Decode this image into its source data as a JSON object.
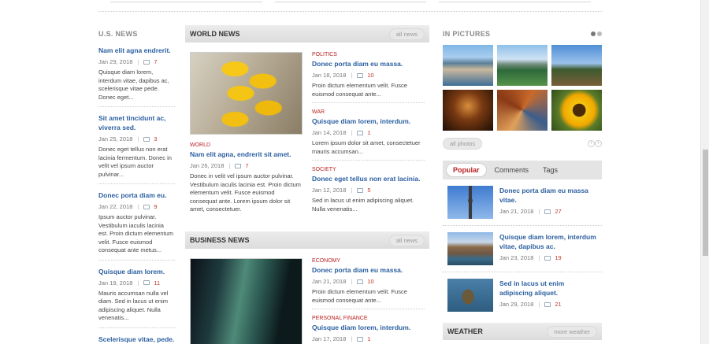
{
  "us_news": {
    "title": "U.S. NEWS",
    "items": [
      {
        "title": "Nam elit agna endrerit.",
        "date": "Jan 29, 2018",
        "comments": "7",
        "text": "Quisque diam lorem, interdum vitae, dapibus ac, scelerisque vitae pede. Donec eget..."
      },
      {
        "title": "Sit amet tincidunt ac, viverra sed.",
        "date": "Jan 25, 2018",
        "comments": "3",
        "text": "Donec eget tellus non erat lacinia fermentum. Donec in velit vel ipsum auctor pulvinar..."
      },
      {
        "title": "Donec porta diam eu.",
        "date": "Jan 22, 2018",
        "comments": "9",
        "text": "Ipsum auctor pulvinar. Vestibulum iaculis lacinia est. Proin dictum elementum velit. Fusce euismod consequat ante metus..."
      },
      {
        "title": "Quisque diam lorem.",
        "date": "Jan 19, 2018",
        "comments": "11",
        "text": "Mauris accumsan nulla vel diam. Sed in lacus ut enim adipiscing aliquet. Nulla venenatis..."
      },
      {
        "title": "Scelerisque vitae, pede.",
        "date": "",
        "comments": "",
        "text": ""
      }
    ]
  },
  "world_news": {
    "title": "WORLD NEWS",
    "all_label": "all news",
    "featured": {
      "category": "WORLD",
      "title": "Nam elit agna, endrerit sit amet.",
      "date": "Jan 26, 2018",
      "comments": "7",
      "text": "Donec in velit vel ipsum auctor pulvinar. Vestibulum iaculis lacinia est. Proin dictum elementum velit. Fusce euismod consequat ante. Lorem ipsum dolor sit amet, consectetuer."
    },
    "items": [
      {
        "category": "POLITICS",
        "title": "Donec porta diam eu massa.",
        "date": "Jan 18, 2018",
        "comments": "10",
        "text": "Proin dictum elementum velit. Fusce euismod consequat ante..."
      },
      {
        "category": "WAR",
        "title": "Quisque diam lorem, interdum.",
        "date": "Jan 14, 2018",
        "comments": "1",
        "text": "Lorem ipsum dolor sit amet, consectetuer mauris accumsan..."
      },
      {
        "category": "SOCIETY",
        "title": "Donec eget tellus non erat lacinia.",
        "date": "Jan 12, 2018",
        "comments": "5",
        "text": "Sed in lacus ut enim adipiscing aliquet. Nulla venenatis..."
      }
    ]
  },
  "business_news": {
    "title": "BUSINESS NEWS",
    "all_label": "all news",
    "items": [
      {
        "category": "ECONOMY",
        "title": "Donec porta diam eu massa.",
        "date": "Jan 21, 2018",
        "comments": "10",
        "text": "Proin dictum elementum velit. Fusce euismod consequat ante..."
      },
      {
        "category": "PERSONAL FINANCE",
        "title": "Quisque diam lorem, interdum.",
        "date": "Jan 17, 2018",
        "comments": "1",
        "text": ""
      }
    ]
  },
  "in_pictures": {
    "title": "IN PICTURES",
    "all_label": "all photos"
  },
  "popular": {
    "tabs": [
      "Popular",
      "Comments",
      "Tags"
    ],
    "items": [
      {
        "title": "Donec porta diam eu massa vitae.",
        "date": "Jan 21, 2018",
        "comments": "27"
      },
      {
        "title": "Quisque diam lorem, interdum vitae, dapibus ac.",
        "date": "Jan 23, 2018",
        "comments": "19"
      },
      {
        "title": "Sed in lacus ut enim adipiscing aliquet.",
        "date": "Jan 29, 2018",
        "comments": "21"
      }
    ]
  },
  "weather": {
    "title": "WEATHER",
    "more_label": "more weather"
  },
  "colors": {
    "link": "#2b5fa0",
    "accent": "#c0392b",
    "category": "#bb2222"
  }
}
